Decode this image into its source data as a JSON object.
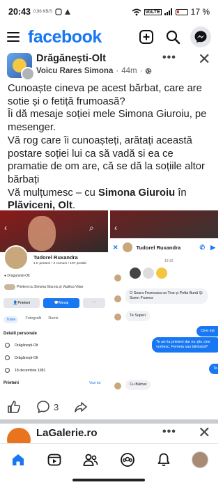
{
  "status_bar": {
    "time": "20:43",
    "battery": "17 %",
    "mini_text": "0,96 KB/S",
    "network_label": "VoLTE"
  },
  "header": {
    "logo": "facebook",
    "icons": [
      "plus-icon",
      "search-icon",
      "messenger-icon"
    ]
  },
  "post": {
    "group_name": "Drăgănești-Olt",
    "author": "Voicu Rares Simona",
    "time": "44m",
    "text_lines": [
      "Cunoaște cineva pe acest bărbat, care are sotie și o fetiță frumoasă?",
      "Îi dă mesaje soției mele Simona Giuroiu, pe mesenger.",
      "Vă rog care îi cunoașteți, arătați această postare soției lui ca să vadă si ea ce pramatie de om are, că se dă la soțiile altor bărbați"
    ],
    "feeling_prefix": "Vă mulțumesc",
    "feeling_dash": " – cu ",
    "tagged": "Simona Giuroiu",
    "in_word": " în ",
    "place": "Plăviceni, Olt",
    "period": "."
  },
  "profile_screenshot": {
    "name": "Tudorel Ruxandra",
    "stats": "1 K prieteni • 2 comuni • 107 postări",
    "location": "Draganesti-Olt",
    "friends_line": "Prieteni cu Simona Giuroiu și Vasilica Vitan",
    "buttons": [
      "Prieteni",
      "Mesaj"
    ],
    "tabs": [
      "Toate",
      "Fotografii",
      "Reels"
    ],
    "section_title": "Detalii personale",
    "rows": [
      "Drăgănești-Olt",
      "Drăgănești-Olt",
      "18 decembrie 1981"
    ],
    "friends_title": "Prieteni",
    "see_all": "Vezi tot"
  },
  "chat_screenshot": {
    "name": "Tudorel Ruxandra",
    "time": "19:32",
    "messages": [
      {
        "dir": "in",
        "text": "O Seara Frumoasa ca Tine și Pofta Bună Și Somn Frumos"
      },
      {
        "dir": "in",
        "text": "Te Superi"
      },
      {
        "dir": "out",
        "text": "Cine eșt"
      },
      {
        "dir": "out",
        "text": "Te am la prieteni dar nu știu cine vorbesc. Femeia sau bărbatul?"
      },
      {
        "dir": "out",
        "text": "Te"
      },
      {
        "dir": "in",
        "text": "Cu Bărbat"
      }
    ]
  },
  "actions": {
    "comments_count": "3"
  },
  "next_post": {
    "name": "LaGalerie.ro"
  },
  "colors": {
    "brand": "#1877f2",
    "text": "#1c1e21",
    "muted": "#65676b"
  }
}
